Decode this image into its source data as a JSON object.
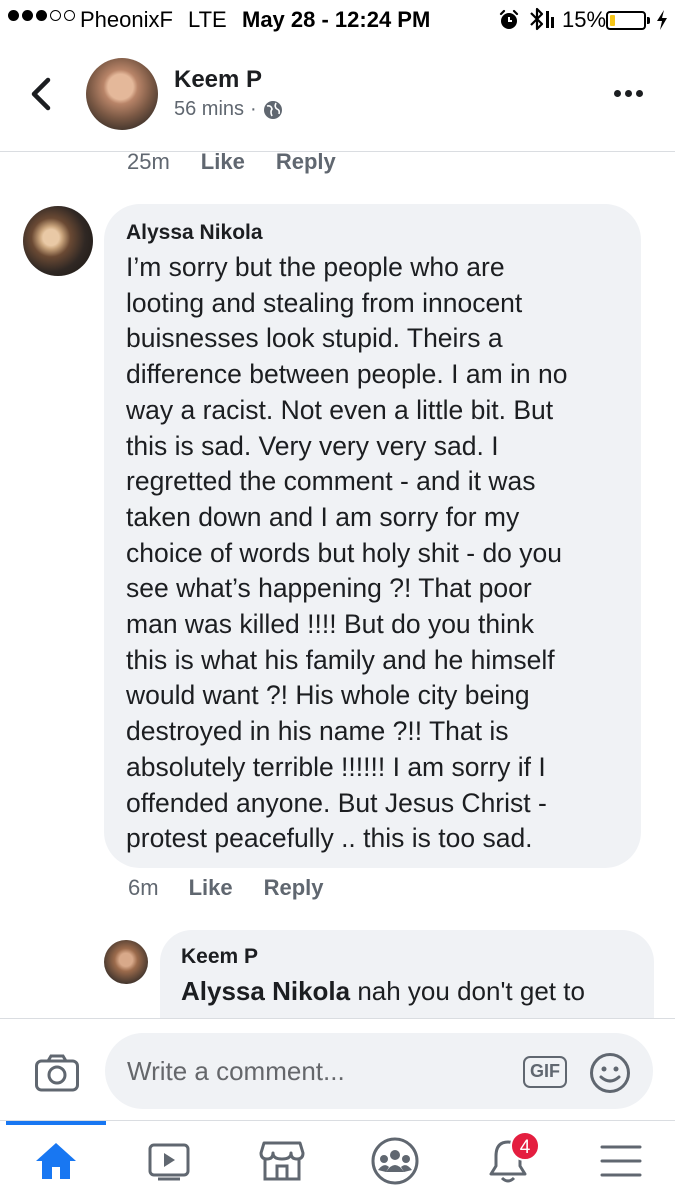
{
  "status_bar": {
    "carrier": "PheonixF",
    "network": "LTE",
    "datetime": "May 28 - 12:24 PM",
    "battery_percent": "15%",
    "battery_level": 0.15,
    "battery_color": "#f5c518",
    "icons": [
      "signal-icon",
      "alarm-icon",
      "bluetooth-icon",
      "battery-icon",
      "charging-icon"
    ]
  },
  "header": {
    "author": "Keem P",
    "time": "56 mins",
    "separator": "·",
    "privacy_icon": "globe-icon",
    "back_icon": "chevron-left-icon",
    "more_icon": "more-icon"
  },
  "previous_comment_actions": {
    "time": "25m",
    "like": "Like",
    "reply": "Reply"
  },
  "comments": [
    {
      "author": "Alyssa Nikola",
      "text": "I’m sorry but the people who are\nlooting and stealing from innocent\nbuisnesses look stupid. Theirs a\ndifference between people. I am in no\nway a racist. Not even a little bit. But\nthis is sad. Very very very sad. I\nregretted the comment - and it was\ntaken down and I am sorry for my\nchoice of words but holy shit - do you\nsee what’s happening ?! That poor\nman was killed !!!! But do you think\nthis is what his family and he himself\nwould want ?! His whole city being\ndestroyed in his name ?!! That is\nabsolutely terrible !!!!!! I am sorry if I\noffended anyone. But Jesus Christ -\nprotest peacefully .. this is too sad.",
      "time": "6m",
      "like": "Like",
      "reply": "Reply"
    },
    {
      "author": "Keem P",
      "mention": "Alyssa Nikola",
      "text": " nah you don't get to"
    }
  ],
  "composer": {
    "placeholder": "Write a comment...",
    "gif_label": "GIF",
    "camera_icon": "camera-icon",
    "emoji_icon": "emoji-icon"
  },
  "nav": {
    "items": [
      "home-icon",
      "video-icon",
      "marketplace-icon",
      "groups-icon",
      "notifications-icon",
      "menu-icon"
    ],
    "active": "home-icon",
    "notification_count": "4",
    "accent": "#1877f2",
    "badge_color": "#e41e3f"
  }
}
